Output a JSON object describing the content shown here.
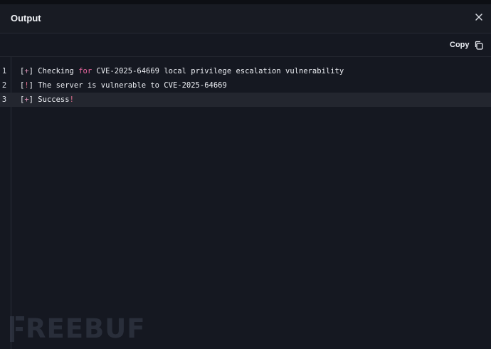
{
  "panel": {
    "title": "Output",
    "copy_label": "Copy"
  },
  "icons": {
    "close": "close-icon",
    "copy": "copy-icon"
  },
  "colors": {
    "background": "#151821",
    "active_line": "#23262f",
    "keyword": "#e7669f",
    "bracket_symbol": "#d98fb4"
  },
  "output": {
    "active_line": 3,
    "lines": [
      {
        "number": "1",
        "open": "[",
        "symbol": "+",
        "close": "]",
        "text_before": " Checking ",
        "keyword": "for",
        "text_after": " CVE-2025-64669 local privilege escalation vulnerability",
        "tail": ""
      },
      {
        "number": "2",
        "open": "[",
        "symbol": "!",
        "close": "]",
        "text_before": " The server is vulnerable to CVE-2025-64669",
        "keyword": "",
        "text_after": "",
        "tail": ""
      },
      {
        "number": "3",
        "open": "[",
        "symbol": "+",
        "close": "]",
        "text_before": " Success",
        "keyword": "",
        "text_after": "",
        "tail": "!"
      }
    ]
  },
  "watermark": {
    "text": "REEBUF"
  }
}
